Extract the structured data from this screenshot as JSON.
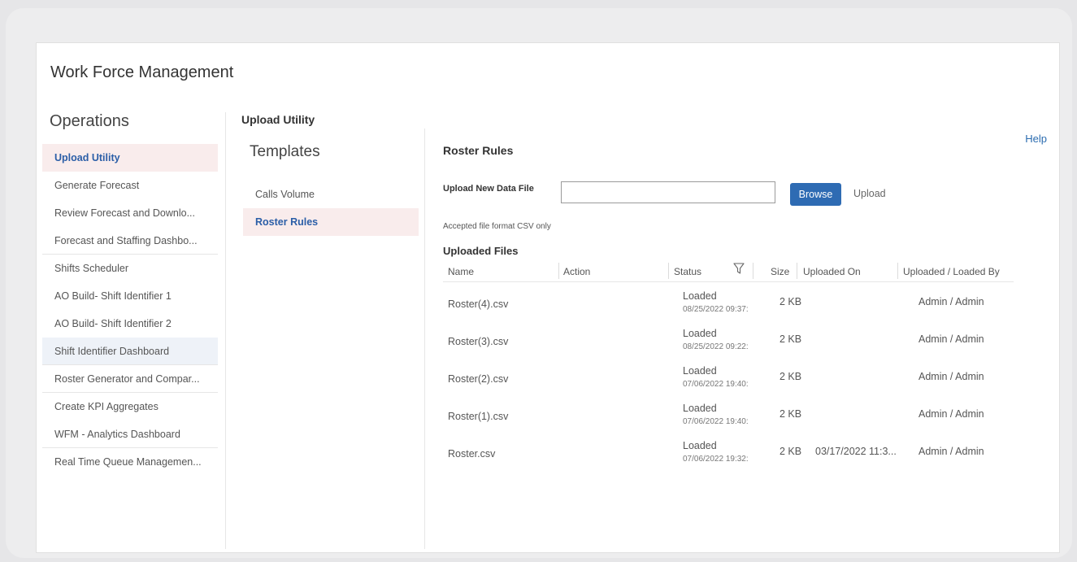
{
  "app": {
    "title": "Work Force Management"
  },
  "operations": {
    "title": "Operations",
    "items": [
      {
        "label": "Upload Utility"
      },
      {
        "label": "Generate Forecast"
      },
      {
        "label": "Review Forecast and Downlo..."
      },
      {
        "label": "Forecast and Staffing Dashbo..."
      },
      {
        "label": "Shifts Scheduler"
      },
      {
        "label": "AO Build- Shift Identifier 1"
      },
      {
        "label": "AO Build- Shift Identifier 2"
      },
      {
        "label": "Shift Identifier Dashboard"
      },
      {
        "label": "Roster Generator and Compar..."
      },
      {
        "label": "Create KPI Aggregates"
      },
      {
        "label": "WFM - Analytics Dashboard"
      },
      {
        "label": "Real Time Queue Managemen..."
      }
    ]
  },
  "upload_utility": {
    "title": "Upload Utility"
  },
  "templates": {
    "title": "Templates",
    "items": [
      {
        "label": "Calls Volume"
      },
      {
        "label": "Roster Rules"
      }
    ]
  },
  "main": {
    "help": "Help",
    "section_title": "Roster Rules",
    "upload_label": "Upload New Data File",
    "file_value": "",
    "browse_label": "Browse",
    "upload_label_btn": "Upload",
    "accepted_note": "Accepted file format CSV only",
    "uploaded_files_title": "Uploaded Files"
  },
  "table": {
    "headers": {
      "name": "Name",
      "action": "Action",
      "status": "Status",
      "size": "Size",
      "uploaded_on": "Uploaded On",
      "uploaded_by": "Uploaded / Loaded By"
    },
    "rows": [
      {
        "name": "Roster(4).csv",
        "status": "Loaded",
        "date": "08/25/2022 09:37:",
        "size": "2 KB",
        "uploaded_on": "",
        "by": "Admin / Admin"
      },
      {
        "name": "Roster(3).csv",
        "status": "Loaded",
        "date": "08/25/2022 09:22:",
        "size": "2 KB",
        "uploaded_on": "",
        "by": "Admin / Admin"
      },
      {
        "name": "Roster(2).csv",
        "status": "Loaded",
        "date": "07/06/2022 19:40:",
        "size": "2 KB",
        "uploaded_on": "",
        "by": "Admin / Admin"
      },
      {
        "name": "Roster(1).csv",
        "status": "Loaded",
        "date": "07/06/2022 19:40:",
        "size": "2 KB",
        "uploaded_on": "",
        "by": "Admin / Admin"
      },
      {
        "name": "Roster.csv",
        "status": "Loaded",
        "date": "07/06/2022 19:32:",
        "size": "2 KB",
        "uploaded_on": "03/17/2022 11:3...",
        "by": "Admin / Admin"
      }
    ]
  },
  "colors": {
    "accent": "#2e6bb3",
    "active_bg": "#f9ecec",
    "active_text": "#2b5ea7"
  },
  "icons": {
    "filter": "filter-icon"
  }
}
